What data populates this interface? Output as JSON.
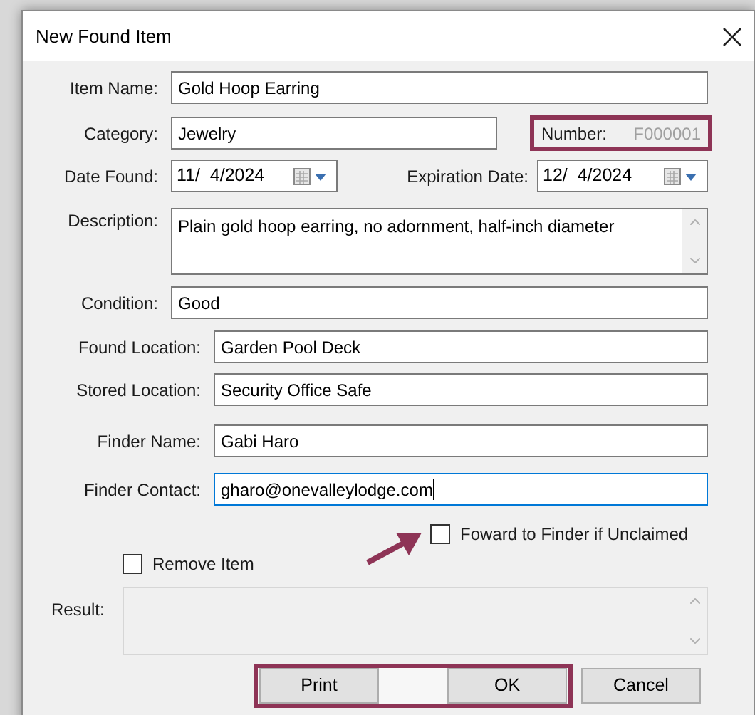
{
  "window": {
    "title": "New Found Item"
  },
  "item_name": {
    "label": "Item Name:",
    "value": "Gold Hoop Earring",
    "focused": false
  },
  "category": {
    "label": "Category:",
    "value": "Jewelry",
    "focused": false
  },
  "number": {
    "label": "Number:",
    "value": "F000001",
    "highlighted": true
  },
  "date_found": {
    "label": "Date Found:",
    "value": "11/  4/2024"
  },
  "expiration_date": {
    "label": "Expiration Date:",
    "value": "12/  4/2024"
  },
  "description": {
    "label": "Description:",
    "value": "Plain gold hoop earring, no adornment, half-inch diameter"
  },
  "condition": {
    "label": "Condition:",
    "value": "Good",
    "focused": false
  },
  "found_location": {
    "label": "Found Location:",
    "value": "Garden Pool Deck",
    "focused": false
  },
  "stored_location": {
    "label": "Stored Location:",
    "value": "Security Office Safe",
    "focused": false
  },
  "finder_name": {
    "label": "Finder Name:",
    "value": "Gabi Haro",
    "focused": false
  },
  "finder_contact": {
    "label": "Finder Contact:",
    "value": "gharo@onevalleylodge.com",
    "focused": true
  },
  "forward_checkbox": {
    "label": "Foward to Finder if Unclaimed",
    "checked": false,
    "arrow_pointer": true
  },
  "remove_checkbox": {
    "label": "Remove Item",
    "checked": false
  },
  "result": {
    "label": "Result:"
  },
  "buttons": {
    "highlighted": true,
    "print": "Print",
    "ok": "OK",
    "cancel": "Cancel"
  }
}
